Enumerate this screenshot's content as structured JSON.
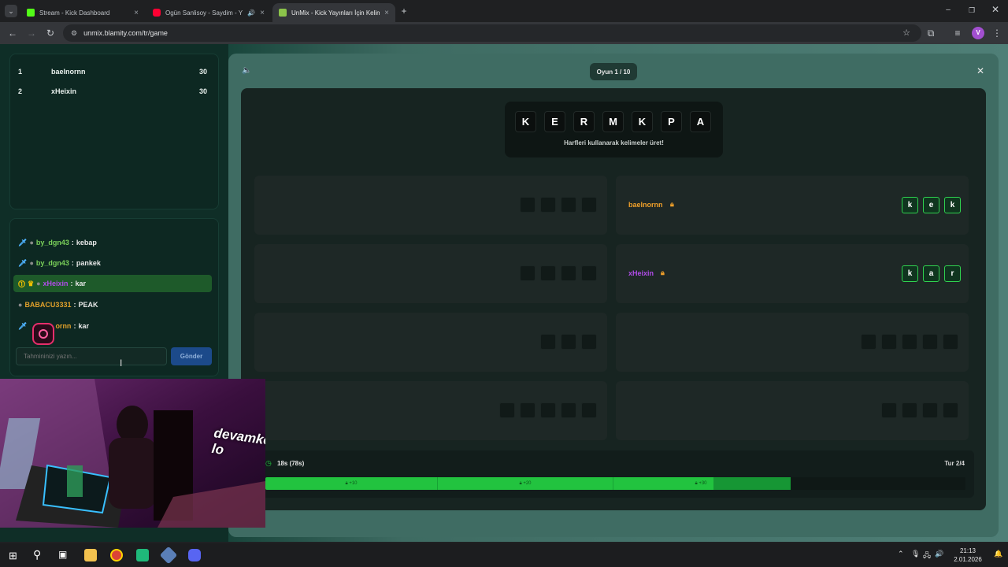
{
  "browser": {
    "tabs": [
      {
        "label": "Stream - Kick Dashboard",
        "color": "#53fc18"
      },
      {
        "label": "Ogün Sanlisoy - Saydim - Y",
        "color": "#ff0033"
      },
      {
        "label": "UnMix - Kick Yayınları İçin Kelim",
        "color": "#8bc34a"
      }
    ],
    "url": "unmix.blamity.com/tr/game",
    "profile_initial": "V"
  },
  "leaderboard": [
    {
      "rank": "1",
      "name": "baelnornn",
      "score": "30"
    },
    {
      "rank": "2",
      "name": "xHeixin",
      "score": "30"
    }
  ],
  "chat": [
    {
      "user": "by_dgn43",
      "sep": ":",
      "msg": "kebap"
    },
    {
      "user": "by_dgn43",
      "sep": ":",
      "msg": "pankek"
    },
    {
      "user": "xHeixin",
      "sep": ":",
      "msg": "kar"
    },
    {
      "user": "BABACU3331",
      "sep": ":",
      "msg": "PEAK"
    },
    {
      "user": "ornn",
      "sep": ":",
      "msg": "kar"
    }
  ],
  "input": {
    "placeholder": "Tahmininizi yazın...",
    "send": "Gönder"
  },
  "game": {
    "round_label": "Oyun 1 / 10",
    "letters": [
      "K",
      "E",
      "R",
      "M",
      "K",
      "P",
      "A"
    ],
    "hint": "Harfleri kullanarak kelimeler üret!",
    "found": [
      {
        "owner": "baelnornn",
        "word": [
          "k",
          "e",
          "k"
        ]
      },
      {
        "owner": "xHeixin",
        "word": [
          "k",
          "a",
          "r"
        ]
      }
    ],
    "timer": "18s (78s)",
    "turn": "Tur 2/4",
    "progress_fraction": 0.75,
    "milestones": [
      "+10",
      "+20",
      "+30"
    ]
  },
  "overlay": {
    "text": "devamke lo"
  },
  "clock": {
    "time": "21:13",
    "date": "2.01.2026"
  },
  "colors": {
    "accent": "#22c33f",
    "owner1": "#f0a02a",
    "owner2": "#b04ce8"
  }
}
